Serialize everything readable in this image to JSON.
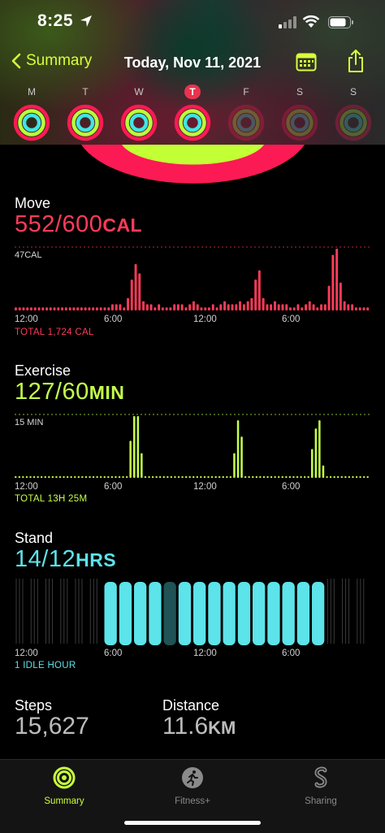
{
  "status": {
    "time": "8:25"
  },
  "nav": {
    "back_label": "Summary",
    "title": "Today, Nov 11, 2021"
  },
  "week": {
    "days": [
      {
        "letter": "M",
        "state": "filled"
      },
      {
        "letter": "T",
        "state": "filled"
      },
      {
        "letter": "W",
        "state": "filled"
      },
      {
        "letter": "T",
        "state": "today"
      },
      {
        "letter": "F",
        "state": "faded"
      },
      {
        "letter": "S",
        "state": "faded"
      },
      {
        "letter": "S",
        "state": "faded"
      }
    ]
  },
  "move": {
    "label": "Move",
    "value": "552/600",
    "unit": "CAL",
    "scale": "47CAL",
    "ticks": [
      "12:00",
      "6:00",
      "12:00",
      "6:00"
    ],
    "total": "TOTAL 1,724 CAL",
    "color": "#ff3b59",
    "bars": [
      1,
      1,
      1,
      1,
      1,
      1,
      1,
      1,
      1,
      1,
      1,
      1,
      1,
      1,
      1,
      1,
      1,
      1,
      1,
      1,
      1,
      1,
      1,
      1,
      1,
      2,
      2,
      2,
      1,
      4,
      10,
      15,
      12,
      3,
      2,
      2,
      1,
      2,
      1,
      1,
      1,
      2,
      2,
      2,
      1,
      2,
      3,
      2,
      1,
      1,
      1,
      2,
      1,
      2,
      3,
      2,
      2,
      2,
      3,
      2,
      3,
      4,
      10,
      13,
      4,
      2,
      2,
      3,
      2,
      2,
      2,
      1,
      1,
      2,
      1,
      2,
      3,
      2,
      1,
      2,
      2,
      8,
      18,
      20,
      9,
      3,
      2,
      2,
      1,
      1,
      1,
      1
    ]
  },
  "exercise": {
    "label": "Exercise",
    "value": "127/60",
    "unit": "MIN",
    "scale": "15 MIN",
    "ticks": [
      "12:00",
      "6:00",
      "12:00",
      "6:00"
    ],
    "total": "TOTAL 13H 25M",
    "color": "#c6ff4a"
  },
  "stand": {
    "label": "Stand",
    "value": "14/12",
    "unit": "HRS",
    "ticks": [
      "12:00",
      "6:00",
      "12:00",
      "6:00"
    ],
    "idle": "1 IDLE HOUR",
    "color": "#5de3ea",
    "hours": [
      0,
      0,
      0,
      0,
      0,
      0,
      1,
      1,
      1,
      1,
      2,
      1,
      1,
      1,
      1,
      1,
      1,
      1,
      1,
      1,
      1,
      0,
      0,
      0
    ]
  },
  "stats": {
    "steps_label": "Steps",
    "steps_value": "15,627",
    "distance_label": "Distance",
    "distance_value": "11.6",
    "distance_unit": "KM"
  },
  "tabs": [
    {
      "label": "Summary",
      "active": true,
      "icon": "activity-rings-icon"
    },
    {
      "label": "Fitness+",
      "active": false,
      "icon": "runner-icon"
    },
    {
      "label": "Sharing",
      "active": false,
      "icon": "sharing-icon"
    }
  ]
}
